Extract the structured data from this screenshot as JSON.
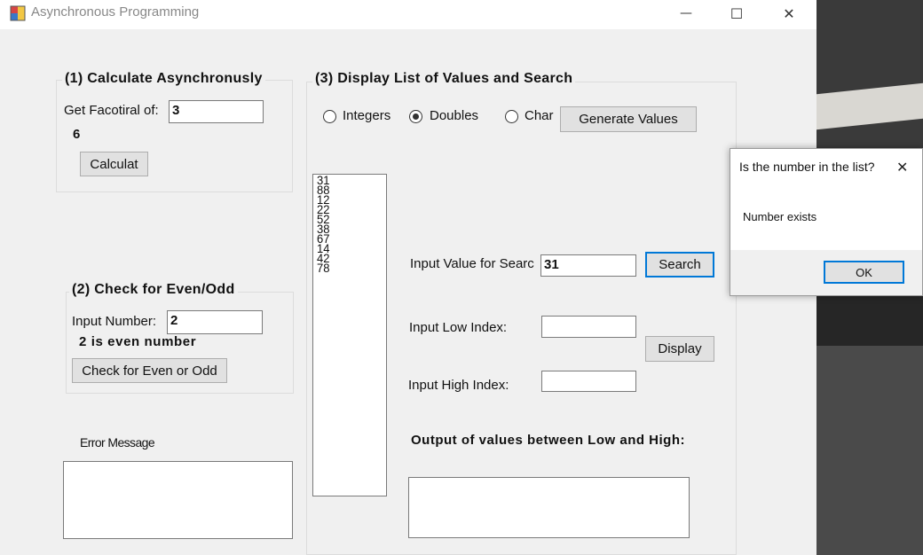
{
  "window": {
    "title": "Asynchronous Programming",
    "minimize_glyph": "—",
    "maximize_glyph": "☐",
    "close_glyph": "✕"
  },
  "group1": {
    "title": "(1) Calculate Asynchronusly",
    "factorial_label": "Get Facotiral of:",
    "factorial_value": "3",
    "result": "6",
    "calculate_button": "Calculat"
  },
  "group2": {
    "title": "(2) Check for Even/Odd",
    "input_label": "Input Number:",
    "input_value": "2",
    "result": "2 is even number",
    "check_button": "Check for Even or Odd"
  },
  "error": {
    "label": "Error Message",
    "value": ""
  },
  "group3": {
    "title": "(3) Display List of Values and Search",
    "radio_options": [
      {
        "label": "Integers",
        "checked": false
      },
      {
        "label": "Doubles",
        "checked": true
      },
      {
        "label": "Char",
        "checked": false
      }
    ],
    "generate_button": "Generate Values",
    "list_values": [
      "31",
      "88",
      "12",
      "22",
      "52",
      "38",
      "67",
      "14",
      "42",
      "78"
    ],
    "search_label": "Input Value for Searc",
    "search_value": "31",
    "search_button": "Search",
    "low_index_label": "Input Low Index:",
    "low_index_value": "",
    "high_index_label": "Input High Index:",
    "high_index_value": "",
    "display_button": "Display",
    "output_label": "Output of values between Low and High:",
    "output_value": ""
  },
  "dialog": {
    "title": "Is the number in the list?",
    "message": "Number exists",
    "ok_button": "OK",
    "close_glyph": "✕"
  },
  "colors": {
    "accent": "#0078d7",
    "window_bg": "#f0f0f0"
  }
}
